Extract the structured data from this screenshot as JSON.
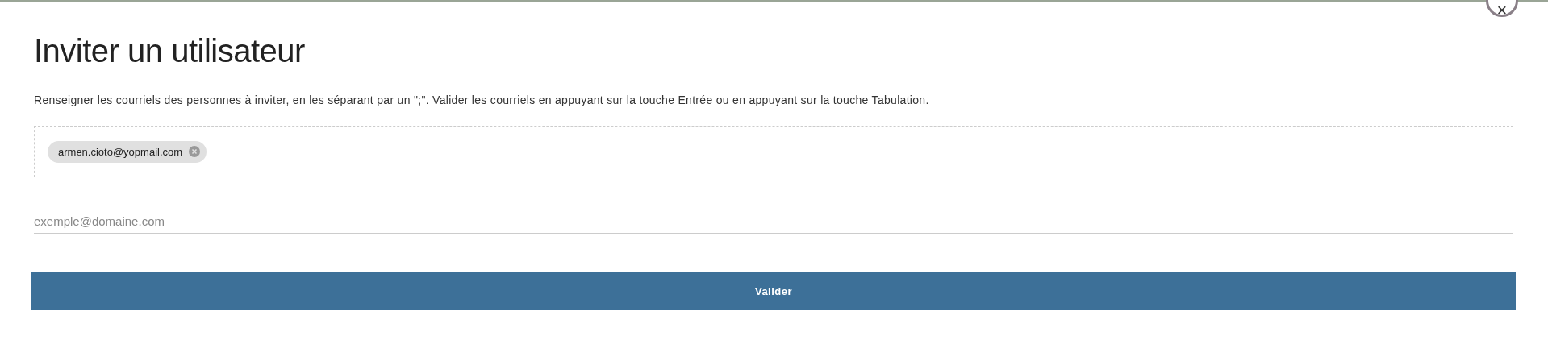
{
  "dialog": {
    "title": "Inviter un utilisateur",
    "close_label": "×",
    "instructions": "Renseigner les courriels des personnes à inviter, en les séparant par un \";\". Valider les courriels en appuyant sur la touche Entrée ou en appuyant sur la touche Tabulation.",
    "emails": [
      {
        "label": "armen.cioto@yopmail.com"
      }
    ],
    "email_field": {
      "placeholder": "exemple@domaine.com"
    },
    "submit": "Valider"
  }
}
